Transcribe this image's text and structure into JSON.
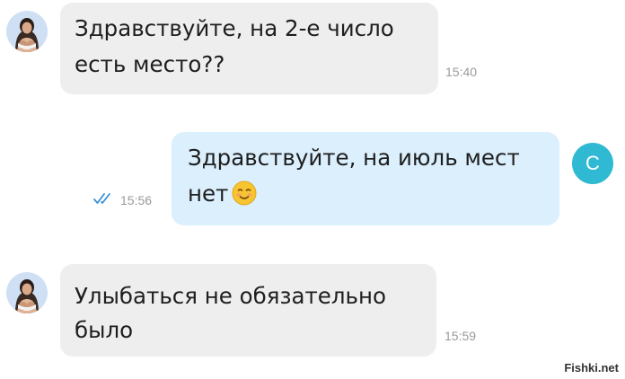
{
  "chat": {
    "messages": [
      {
        "direction": "incoming",
        "line1": "Здравствуйте, на 2-е число",
        "line2": "есть место??",
        "time": "15:40"
      },
      {
        "direction": "outgoing",
        "line1": "Здравствуйте, на июль мест",
        "line2": "нет",
        "emoji": "smiling-face-emoji",
        "time": "15:56",
        "status": "read"
      },
      {
        "direction": "incoming",
        "line1": "Улыбаться не обязательно",
        "line2": "было",
        "time": "15:59"
      }
    ],
    "outgoing_avatar_letter": "C"
  },
  "watermark": "Fishki.net",
  "colors": {
    "incoming_bubble": "#eeeeee",
    "outgoing_bubble": "#dbeffd",
    "avatar_accent": "#2fb9d3",
    "read_ticks": "#3a8fd6",
    "timestamp": "#9a9a9a"
  }
}
